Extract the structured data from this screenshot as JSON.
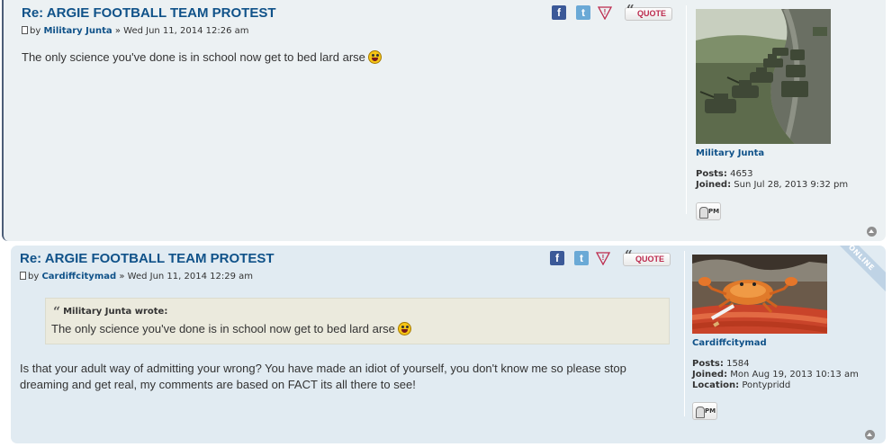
{
  "posts": [
    {
      "title": "Re: ARGIE FOOTBALL TEAM PROTEST",
      "by": "by",
      "author": "Military Junta",
      "sep": "»",
      "date": "Wed Jun 11, 2014 12:26 am",
      "content": "The only science you've done is in school now get to bed lard arse",
      "buttons": {
        "facebook": "f",
        "twitter": "t",
        "report": "!",
        "quote": "QUOTE"
      },
      "profile": {
        "name": "Military Junta",
        "posts_label": "Posts:",
        "posts": "4653",
        "joined_label": "Joined:",
        "joined": "Sun Jul 28, 2013 9:32 pm",
        "pm": "PM"
      }
    },
    {
      "title": "Re: ARGIE FOOTBALL TEAM PROTEST",
      "by": "by",
      "author": "Cardiffcitymad",
      "sep": "»",
      "date": "Wed Jun 11, 2014 12:29 am",
      "quote": {
        "cite": "Military Junta wrote:",
        "text": "The only science you've done is in school now get to bed lard arse"
      },
      "content": "Is that your adult way of admitting your wrong? You have made an idiot of yourself, you don't know me so please stop dreaming and get real, my comments are based on FACT its all there to see!",
      "buttons": {
        "facebook": "f",
        "twitter": "t",
        "report": "!",
        "quote": "QUOTE"
      },
      "online": "ONLINE",
      "profile": {
        "name": "Cardiffcitymad",
        "posts_label": "Posts:",
        "posts": "1584",
        "joined_label": "Joined:",
        "joined": "Mon Aug 19, 2013 10:13 am",
        "location_label": "Location:",
        "location": "Pontypridd",
        "pm": "PM"
      }
    }
  ],
  "colors": {
    "post1_bg": "#ecf1f3",
    "post2_bg": "#e1ebf2",
    "link": "#105289",
    "quote_red": "#bc2a4d"
  }
}
